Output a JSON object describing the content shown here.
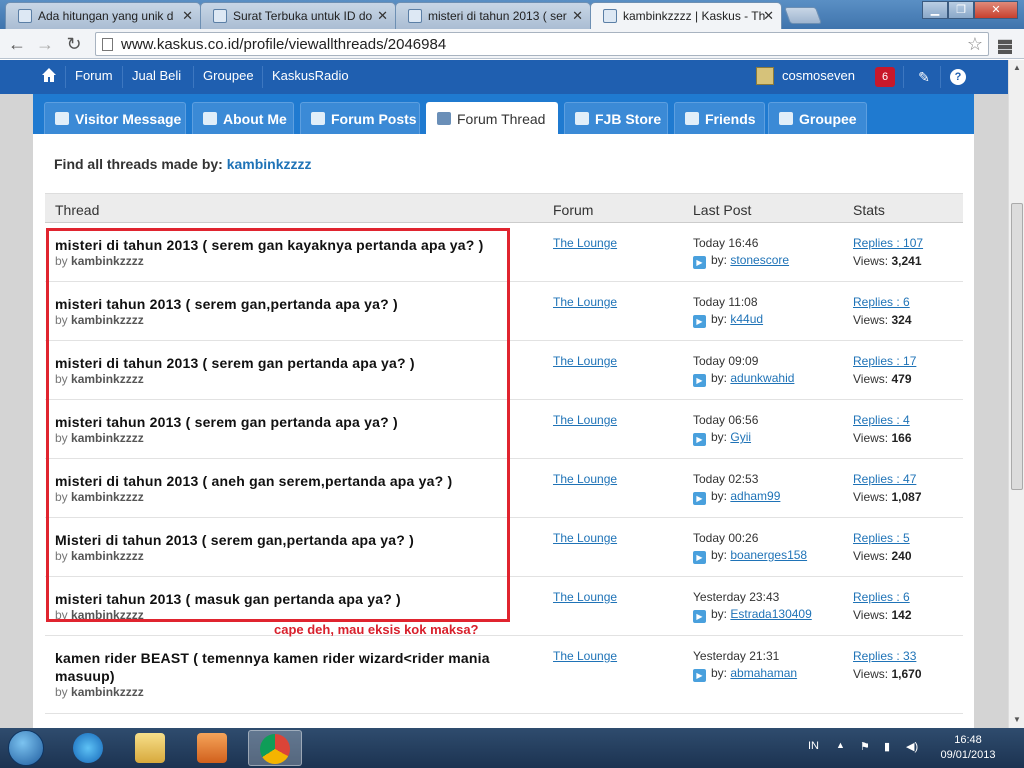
{
  "browser": {
    "tabs": [
      {
        "label": "Ada hitungan yang unik d"
      },
      {
        "label": "Surat Terbuka untuk ID do"
      },
      {
        "label": "misteri di tahun 2013 ( ser"
      },
      {
        "label": "kambinkzzzz | Kaskus - Th"
      }
    ],
    "url": "www.kaskus.co.id/profile/viewallthreads/2046984"
  },
  "site_nav": {
    "items": [
      "Forum",
      "Jual Beli",
      "Groupee",
      "KaskusRadio"
    ],
    "username": "cosmoseven",
    "notif_count": "6"
  },
  "profile_tabs": [
    "Visitor Message",
    "About Me",
    "Forum Posts",
    "Forum Thread",
    "FJB Store",
    "Friends",
    "Groupee"
  ],
  "find": {
    "label": "Find all threads made by:",
    "user": "kambinkzzzz"
  },
  "table": {
    "headers": [
      "Thread",
      "Forum",
      "Last Post",
      "Stats"
    ],
    "rows": [
      {
        "title": "misteri di tahun 2013 ( serem gan kayaknya pertanda apa ya? )",
        "by": "by",
        "author": "kambinkzzzz",
        "forum": "The Lounge",
        "time": "Today 16:46",
        "by_label": "by:",
        "last_user": "stonescore",
        "replies": "Replies : 107",
        "views_label": "Views:",
        "views": "3,241"
      },
      {
        "title": "misteri tahun 2013 ( serem gan,pertanda apa ya? )",
        "by": "by",
        "author": "kambinkzzzz",
        "forum": "The Lounge",
        "time": "Today 11:08",
        "by_label": "by:",
        "last_user": "k44ud",
        "replies": "Replies : 6",
        "views_label": "Views:",
        "views": "324"
      },
      {
        "title": "misteri di tahun 2013 ( serem gan pertanda apa ya? )",
        "by": "by",
        "author": "kambinkzzzz",
        "forum": "The Lounge",
        "time": "Today 09:09",
        "by_label": "by:",
        "last_user": "adunkwahid",
        "replies": "Replies : 17",
        "views_label": "Views:",
        "views": "479"
      },
      {
        "title": "misteri tahun 2013 ( serem gan pertanda apa ya? )",
        "by": "by",
        "author": "kambinkzzzz",
        "forum": "The Lounge",
        "time": "Today 06:56",
        "by_label": "by:",
        "last_user": "Gyii",
        "replies": "Replies : 4",
        "views_label": "Views:",
        "views": "166"
      },
      {
        "title": "misteri di tahun 2013 ( aneh gan serem,pertanda apa ya? )",
        "by": "by",
        "author": "kambinkzzzz",
        "forum": "The Lounge",
        "time": "Today 02:53",
        "by_label": "by:",
        "last_user": "adham99",
        "replies": "Replies : 47",
        "views_label": "Views:",
        "views": "1,087"
      },
      {
        "title": "Misteri di tahun 2013 ( serem gan,pertanda apa ya? )",
        "by": "by",
        "author": "kambinkzzzz",
        "forum": "The Lounge",
        "time": "Today 00:26",
        "by_label": "by:",
        "last_user": "boanerges158",
        "replies": "Replies : 5",
        "views_label": "Views:",
        "views": "240"
      },
      {
        "title": "misteri tahun 2013 ( masuk gan pertanda apa ya? )",
        "by": "by",
        "author": "kambinkzzzz",
        "forum": "The Lounge",
        "time": "Yesterday 23:43",
        "by_label": "by:",
        "last_user": "Estrada130409",
        "replies": "Replies : 6",
        "views_label": "Views:",
        "views": "142"
      },
      {
        "title": "kamen rider BEAST ( temennya kamen rider wizard<rider mania masuup)",
        "by": "by",
        "author": "kambinkzzzz",
        "forum": "The Lounge",
        "time": "Yesterday 21:31",
        "by_label": "by:",
        "last_user": "abmahaman",
        "replies": "Replies : 33",
        "views_label": "Views:",
        "views": "1,670"
      }
    ]
  },
  "annotation": {
    "caption": "cape deh, mau eksis kok maksa?",
    "color": "#e0242f"
  },
  "taskbar": {
    "lang": "IN",
    "time": "16:48",
    "date": "09/01/2013"
  },
  "colors": {
    "brand_blue": "#1f5fb0",
    "tab_blue": "#1f7ad0",
    "link": "#1f73b7"
  },
  "icons": [
    "windows-start-icon",
    "ie-icon",
    "explorer-icon",
    "media-player-icon",
    "chrome-icon",
    "home-icon",
    "pencil-icon",
    "help-icon"
  ]
}
